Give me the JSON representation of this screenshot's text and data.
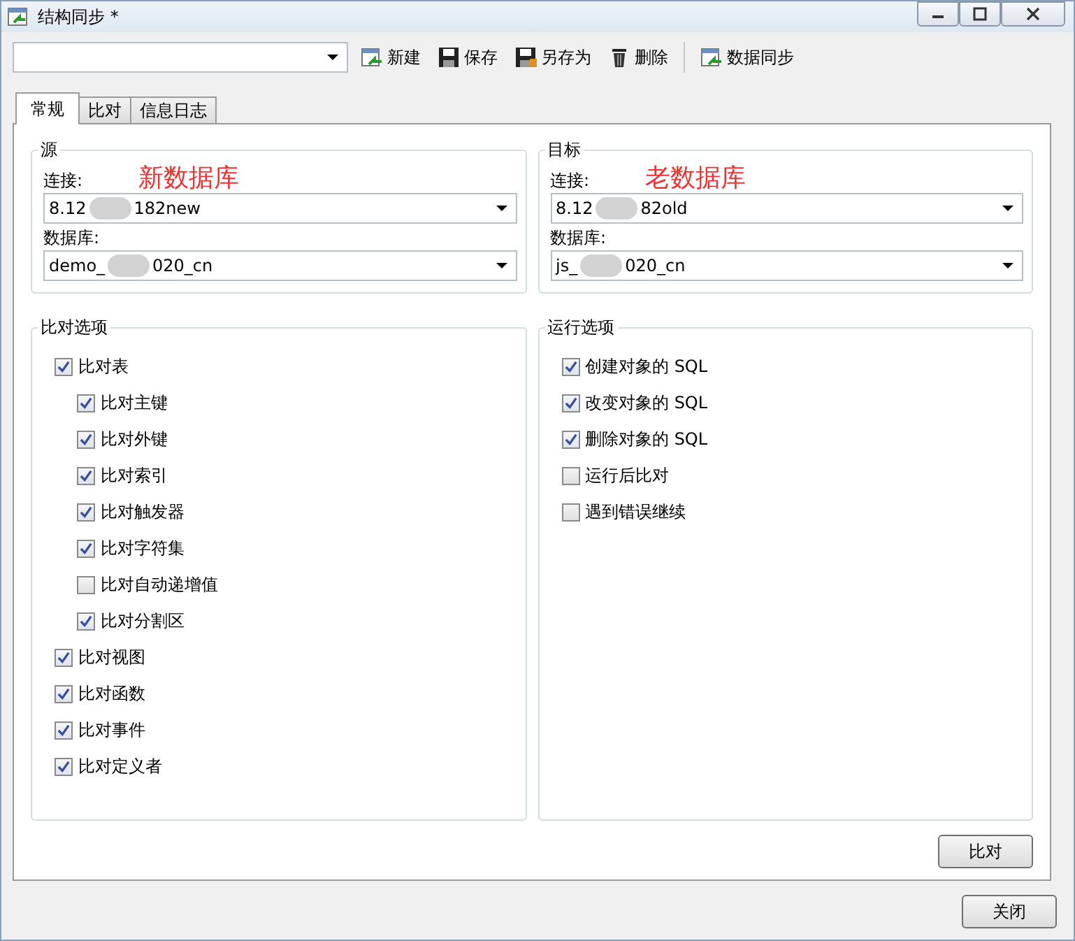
{
  "window": {
    "title": "结构同步 *"
  },
  "toolbar": {
    "buttons": [
      {
        "label": "新建",
        "kind": "new"
      },
      {
        "label": "保存",
        "kind": "save"
      },
      {
        "label": "另存为",
        "kind": "saveas"
      },
      {
        "label": "删除",
        "kind": "delete"
      },
      {
        "label": "数据同步",
        "kind": "sync"
      }
    ]
  },
  "tabs": [
    {
      "label": "常规",
      "selected": true
    },
    {
      "label": "比对",
      "selected": false
    },
    {
      "label": "信息日志",
      "selected": false
    }
  ],
  "groups": [
    {
      "title": "源",
      "annotation": "新数据库",
      "connection_label": "连接:",
      "connection_parts": [
        "8.12",
        "182new"
      ],
      "database_label": "数据库:",
      "database_parts": [
        "demo_",
        "020_cn"
      ]
    },
    {
      "title": "目标",
      "annotation": "老数据库",
      "connection_label": "连接:",
      "connection_parts": [
        "8.12",
        "82old"
      ],
      "database_label": "数据库:",
      "database_parts": [
        "js_",
        "020_cn"
      ]
    }
  ],
  "compare_options": {
    "title": "比对选项",
    "items": [
      {
        "label": "比对表",
        "checked": true,
        "children": [
          {
            "label": "比对主键",
            "checked": true
          },
          {
            "label": "比对外键",
            "checked": true
          },
          {
            "label": "比对索引",
            "checked": true
          },
          {
            "label": "比对触发器",
            "checked": true
          },
          {
            "label": "比对字符集",
            "checked": true
          },
          {
            "label": "比对自动递增值",
            "checked": false
          },
          {
            "label": "比对分割区",
            "checked": true
          }
        ]
      },
      {
        "label": "比对视图",
        "checked": true
      },
      {
        "label": "比对函数",
        "checked": true
      },
      {
        "label": "比对事件",
        "checked": true
      },
      {
        "label": "比对定义者",
        "checked": true
      }
    ]
  },
  "run_options": {
    "title": "运行选项",
    "items": [
      {
        "label": "创建对象的 SQL",
        "checked": true
      },
      {
        "label": "改变对象的 SQL",
        "checked": true
      },
      {
        "label": "删除对象的 SQL",
        "checked": true
      },
      {
        "label": "运行后比对",
        "checked": false
      },
      {
        "label": "遇到错误继续",
        "checked": false
      }
    ]
  },
  "compare_button": "比对",
  "close_button": "关闭"
}
